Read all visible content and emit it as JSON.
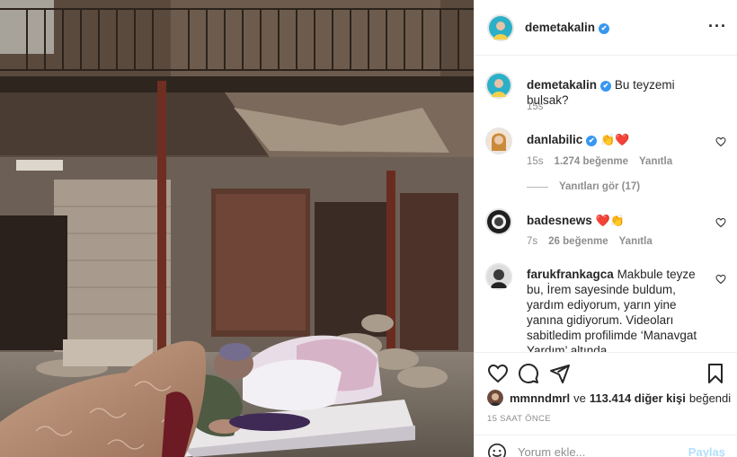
{
  "post": {
    "author": "demetakalin",
    "verified_mark": "✔",
    "more_icon": "more-horizontal-icon"
  },
  "caption": {
    "username": "demetakalin",
    "text": "Bu teyzemi bulsak?",
    "time": "15s"
  },
  "comments": [
    {
      "username": "danlabilic",
      "text": "👏❤️",
      "time": "15s",
      "likes": "1.274 beğenme",
      "reply": "Yanıtla",
      "view_replies": "Yanıtları gör (17)"
    },
    {
      "username": "badesnews",
      "text": "❤️👏",
      "time": "7s",
      "likes": "26 beğenme",
      "reply": "Yanıtla"
    },
    {
      "username": "farukfrankagca",
      "text": "Makbule teyze bu, İrem sayesinde buldum, yardım ediyorum, yarın yine yanına gidiyorum. Videoları sabitledim profilimde ‘Manavgat Yardım’ altında"
    }
  ],
  "actions": {
    "like_icon": "heart-icon",
    "comment_icon": "comment-icon",
    "share_icon": "paper-plane-icon",
    "save_icon": "bookmark-icon"
  },
  "likes": {
    "user": "mmnndmrl",
    "connector": "ve",
    "count": "113.414 diğer kişi",
    "suffix": "beğendi"
  },
  "timestamp": "15 SAAT ÖNCE",
  "add_comment": {
    "placeholder": "Yorum ekle...",
    "post_label": "Paylaş"
  },
  "colors": {
    "accent": "#3897f0",
    "like_red": "#ed4956",
    "post_disabled": "#b2dffc",
    "muted": "#8e8e8e"
  }
}
